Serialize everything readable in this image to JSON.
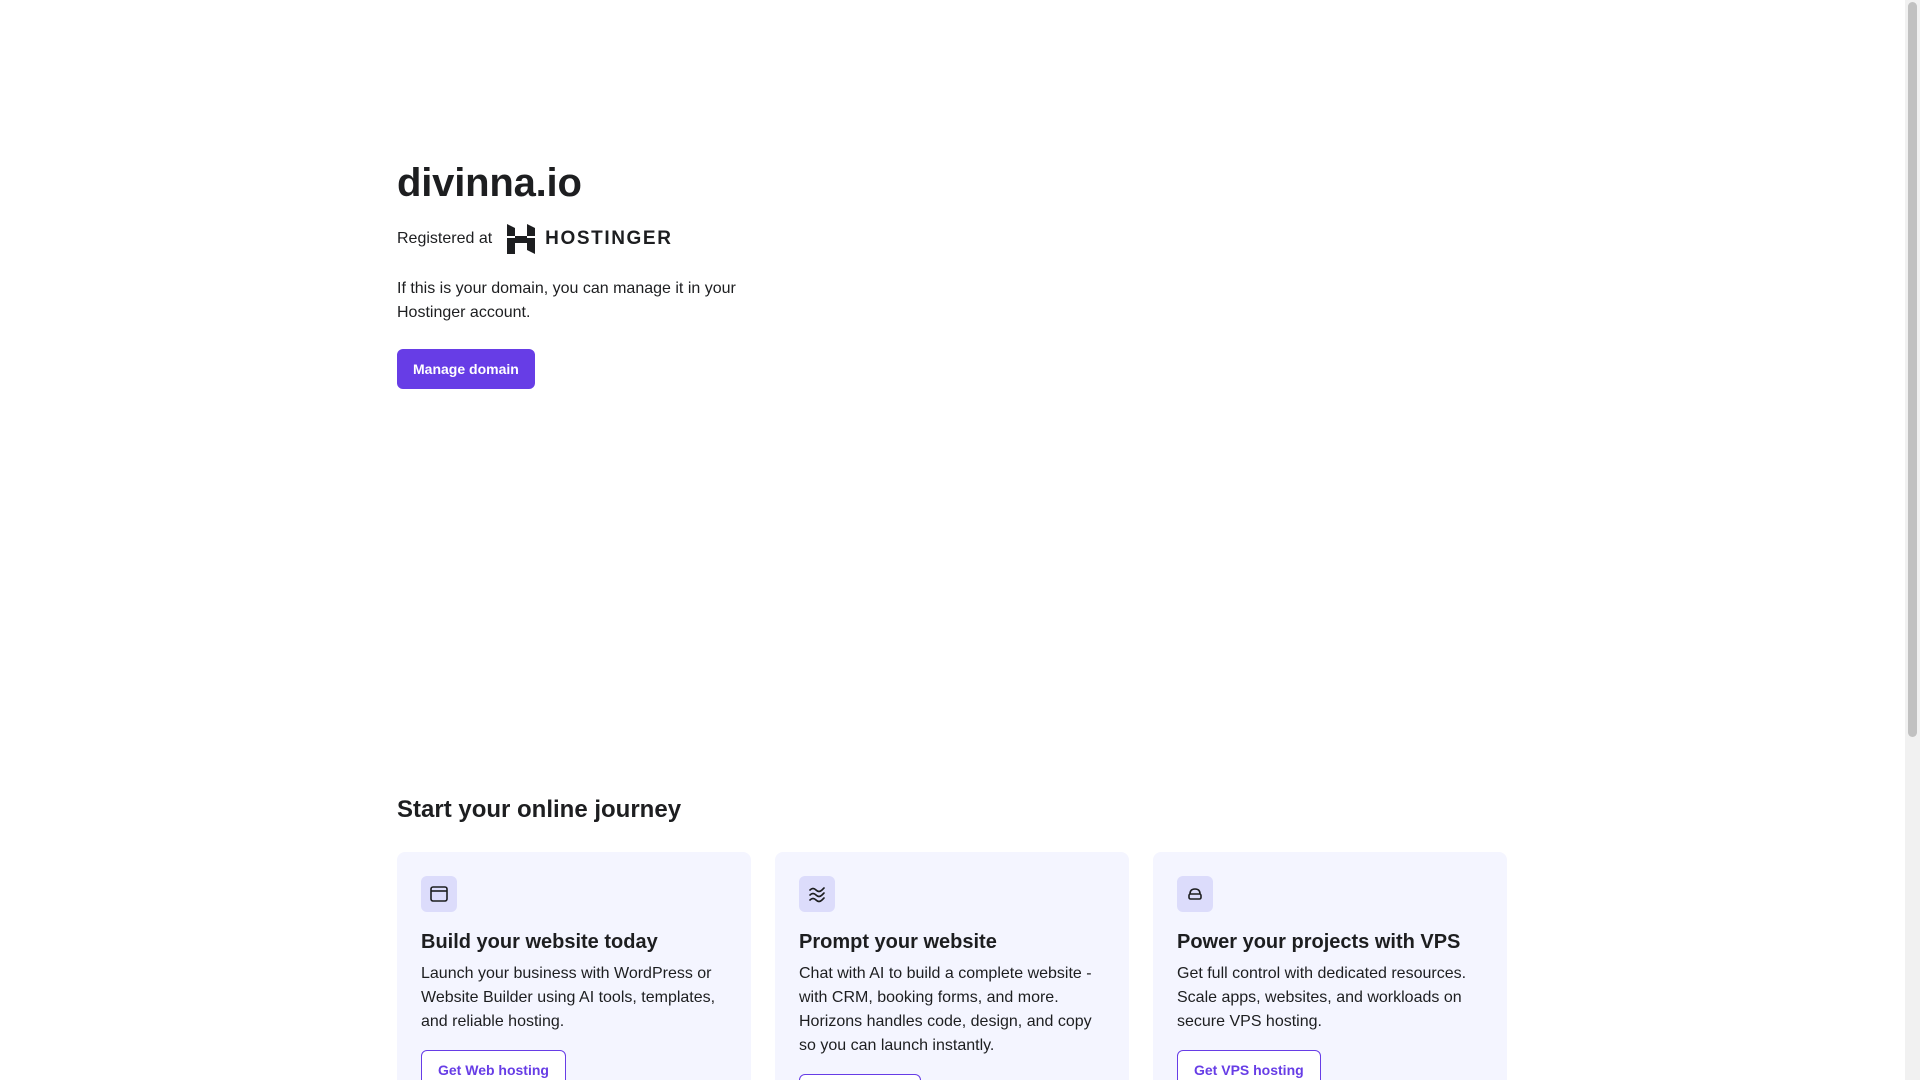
{
  "hero": {
    "domain": "divinna.io",
    "registered_label": "Registered at",
    "registrar_logo_icon": "hostinger-logo-icon",
    "registrar_name": "HOSTINGER",
    "description": "If this is your domain, you can manage it in your Hostinger account.",
    "manage_button": "Manage domain"
  },
  "journey": {
    "title": "Start your online journey",
    "cards": [
      {
        "icon": "browser-window-icon",
        "title": "Build your website today",
        "description": "Launch your business with WordPress or Website Builder using AI tools, templates, and reliable hosting.",
        "button": "Get Web hosting"
      },
      {
        "icon": "ai-waves-icon",
        "title": "Prompt your website",
        "description": "Chat with AI to build a complete website - with CRM, booking forms, and more. Horizons handles code, design, and copy so you can launch instantly.",
        "button": ""
      },
      {
        "icon": "cloud-server-icon",
        "title": "Power your projects with VPS",
        "description": "Get full control with dedicated resources. Scale apps, websites, and workloads on secure VPS hosting.",
        "button": "Get VPS hosting"
      }
    ]
  },
  "colors": {
    "accent": "#673de6",
    "card_background": "#f4f5ff",
    "icon_background": "#dcdcfb",
    "text": "#1d1e20"
  }
}
